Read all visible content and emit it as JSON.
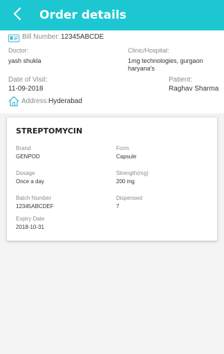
{
  "header": {
    "title": "Order details",
    "back_icon": "chevron-left-icon"
  },
  "colors": {
    "accent": "#1cc7d2",
    "icon": "#3fb7d6"
  },
  "order": {
    "bill_label": "Bill Number:",
    "bill_value": "12345ABCDE",
    "bill_icon": "id-card-icon",
    "doctor_label": "Doctor:",
    "doctor_value": "yash shukla",
    "clinic_label": "Clinic/Hospital:",
    "clinic_line1": "1mg technologies, gurgaon",
    "clinic_line2": "haryana's",
    "visit_label": "Date of Visit:",
    "visit_value": "11-09-2018",
    "patient_label": "Patient:",
    "patient_value": "Raghav Sharma",
    "address_label": "Address:",
    "address_value": "Hyderabad",
    "address_icon": "home-icon"
  },
  "medicine": {
    "name": "STREPTOMYCIN",
    "fields": [
      {
        "label": "Brand",
        "value": "GENPOD"
      },
      {
        "label": "Form",
        "value": "Capsule"
      },
      {
        "label": "Dosage",
        "value": "Once a day"
      },
      {
        "label": "Strength(mg)",
        "value": "200 mg"
      },
      {
        "label": "Batch Number",
        "value": "12345ABCDEF"
      },
      {
        "label": "Dispensed",
        "value": "7"
      },
      {
        "label": "Expiry Date",
        "value": "2018-10-31"
      }
    ]
  }
}
